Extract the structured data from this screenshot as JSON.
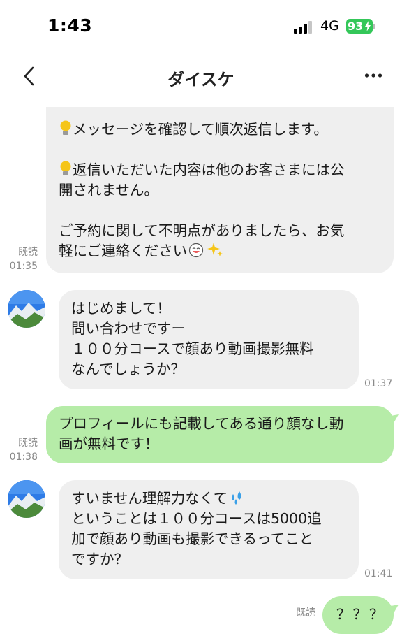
{
  "status_bar": {
    "time": "1:43",
    "network": "4G",
    "battery": "93"
  },
  "header": {
    "title": "ダイスケ"
  },
  "messages": [
    {
      "sender": "me",
      "lines": [
        "メッセージを確認して順次返信します。",
        "",
        "返信いただいた内容は他のお客さまには公",
        "開されません。",
        "",
        "ご予約に関して不明点がありましたら、お気",
        "軽にご連絡ください"
      ],
      "read": "既読",
      "time": "01:35"
    },
    {
      "sender": "other",
      "lines": [
        "はじめまして！",
        "問い合わせですー",
        "１００分コースで顔あり動画撮影無料",
        "なんでしょうか？"
      ],
      "time": "01:37"
    },
    {
      "sender": "me",
      "lines": [
        "プロフィールにも記載してある通り顔なし動",
        "画が無料です！"
      ],
      "read": "既読",
      "time": "01:38"
    },
    {
      "sender": "other",
      "lines": [
        "すいません理解力なくて",
        "ということは１００分コースは5000追",
        "加で顔あり動画も撮影できるってこと",
        "ですか？"
      ],
      "time": "01:41"
    },
    {
      "sender": "me",
      "lines": [
        "？？？"
      ],
      "read": "既読"
    }
  ],
  "colors": {
    "sent_bubble": "#b6eca8",
    "received_bubble": "#efefef",
    "battery": "#34c759"
  },
  "icons": [
    "back-chevron-icon",
    "more-dots-icon",
    "light-bulb-icon",
    "grinning-emoji-icon",
    "sparkles-icon",
    "sweat-droplets-icon"
  ]
}
